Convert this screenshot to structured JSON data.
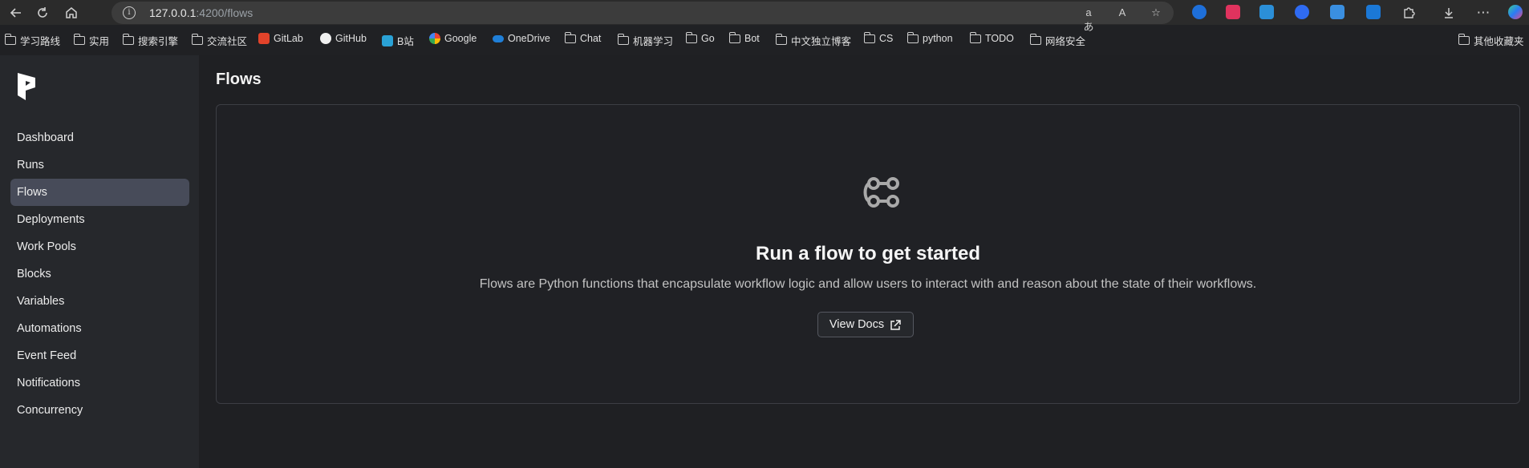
{
  "browser": {
    "url_host": "127.0.0.1",
    "url_path": ":4200/flows"
  },
  "bookmarks": [
    {
      "label": "学习路线",
      "icon": "folder-icon"
    },
    {
      "label": "实用",
      "icon": "folder-icon"
    },
    {
      "label": "搜索引擎",
      "icon": "folder-icon"
    },
    {
      "label": "交流社区",
      "icon": "folder-icon"
    },
    {
      "label": "GitLab",
      "icon": "gitlab-icon"
    },
    {
      "label": "GitHub",
      "icon": "github-icon"
    },
    {
      "label": "B站",
      "icon": "bilibili-icon"
    },
    {
      "label": "Google",
      "icon": "google-icon"
    },
    {
      "label": "OneDrive",
      "icon": "onedrive-icon"
    },
    {
      "label": "Chat",
      "icon": "folder-icon"
    },
    {
      "label": "机器学习",
      "icon": "folder-icon"
    },
    {
      "label": "Go",
      "icon": "folder-icon"
    },
    {
      "label": "Bot",
      "icon": "folder-icon"
    },
    {
      "label": "中文独立博客",
      "icon": "folder-icon"
    },
    {
      "label": "CS",
      "icon": "folder-icon"
    },
    {
      "label": "python",
      "icon": "folder-icon"
    },
    {
      "label": "TODO",
      "icon": "folder-icon"
    },
    {
      "label": "网络安全",
      "icon": "folder-icon"
    }
  ],
  "other_bookmarks": "其他收藏夹",
  "sidebar": {
    "items": [
      {
        "label": "Dashboard"
      },
      {
        "label": "Runs"
      },
      {
        "label": "Flows",
        "active": true
      },
      {
        "label": "Deployments"
      },
      {
        "label": "Work Pools"
      },
      {
        "label": "Blocks"
      },
      {
        "label": "Variables"
      },
      {
        "label": "Automations"
      },
      {
        "label": "Event Feed"
      },
      {
        "label": "Notifications"
      },
      {
        "label": "Concurrency"
      }
    ]
  },
  "main": {
    "title": "Flows",
    "empty_heading": "Run a flow to get started",
    "empty_description": "Flows are Python functions that encapsulate workflow logic and allow users to interact with and reason about the state of their workflows.",
    "docs_button": "View Docs"
  },
  "colors": {
    "active_nav": "#474b59",
    "sidebar_bg": "#26282c",
    "main_bg": "#1f2023"
  }
}
